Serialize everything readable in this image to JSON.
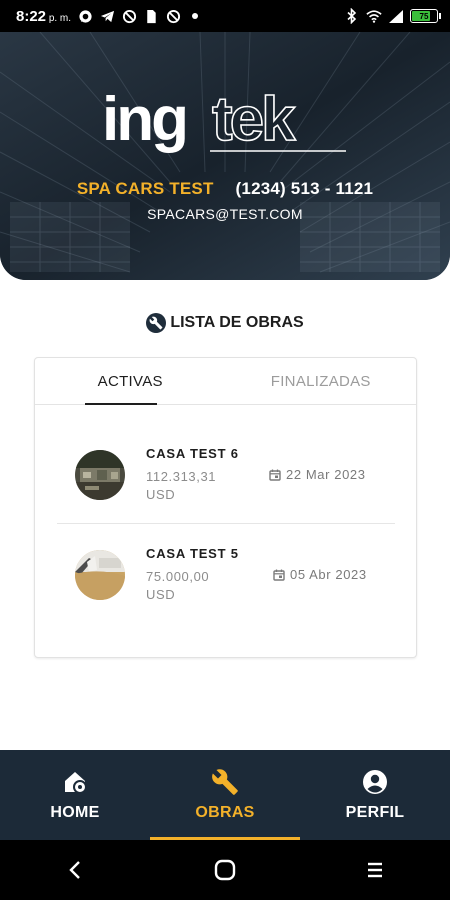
{
  "status_bar": {
    "time": "8:22",
    "ampm": "p. m.",
    "battery_level": "75",
    "battery_fraction": 0.75,
    "left_icons": [
      "whatsapp-icon",
      "telegram-icon",
      "blocked-icon",
      "sim-icon",
      "blocked-icon",
      "dot-icon"
    ],
    "right_icons": [
      "bluetooth-icon",
      "wifi-icon",
      "signal-icon",
      "battery-icon"
    ]
  },
  "header": {
    "logo_part1": "ing",
    "logo_part2": "tek",
    "company_name": "SPA CARS TEST",
    "phone": "(1234) 513 - 1121",
    "email": "SPACARS@TEST.COM"
  },
  "section": {
    "title": "LISTA DE OBRAS",
    "icon": "wrench-circle-icon"
  },
  "tabs": [
    {
      "label": "ACTIVAS",
      "active": true
    },
    {
      "label": "FINALIZADAS",
      "active": false
    }
  ],
  "obras": [
    {
      "name": "CASA TEST 6",
      "amount": "112.313,31",
      "currency": "USD",
      "date": "22 Mar 2023",
      "icon": "calendar-icon"
    },
    {
      "name": "CASA TEST 5",
      "amount": "75.000,00",
      "currency": "USD",
      "date": "05 Abr 2023",
      "icon": "calendar-icon"
    }
  ],
  "bottom_nav": [
    {
      "label": "HOME",
      "icon": "home-icon",
      "active": false
    },
    {
      "label": "OBRAS",
      "icon": "wrench-icon",
      "active": true
    },
    {
      "label": "PERFIL",
      "icon": "account-circle-icon",
      "active": false
    }
  ],
  "android_nav": [
    "back-icon",
    "home-circle-icon",
    "recents-icon"
  ],
  "colors": {
    "accent": "#f3b12a",
    "navy": "#1c2a38",
    "text": "#1e1e1e",
    "muted": "#9c9c9c"
  }
}
